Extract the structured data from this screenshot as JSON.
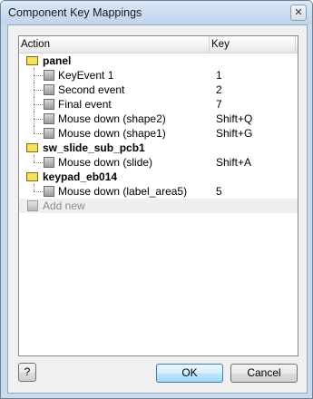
{
  "window": {
    "title": "Component Key Mappings",
    "close_symbol": "✕"
  },
  "grid": {
    "columns": {
      "action": "Action",
      "key": "Key"
    },
    "groups": [
      {
        "name": "panel",
        "items": [
          {
            "action": "KeyEvent 1",
            "key": "1"
          },
          {
            "action": "Second event",
            "key": "2"
          },
          {
            "action": "Final event",
            "key": "7"
          },
          {
            "action": "Mouse down (shape2)",
            "key": "Shift+Q"
          },
          {
            "action": "Mouse down (shape1)",
            "key": "Shift+G"
          }
        ]
      },
      {
        "name": "sw_slide_sub_pcb1",
        "items": [
          {
            "action": "Mouse down (slide)",
            "key": "Shift+A"
          }
        ]
      },
      {
        "name": "keypad_eb014",
        "items": [
          {
            "action": "Mouse down (label_area5)",
            "key": "5"
          }
        ]
      }
    ],
    "add_new_label": "Add new"
  },
  "buttons": {
    "help": "?",
    "ok": "OK",
    "cancel": "Cancel"
  }
}
